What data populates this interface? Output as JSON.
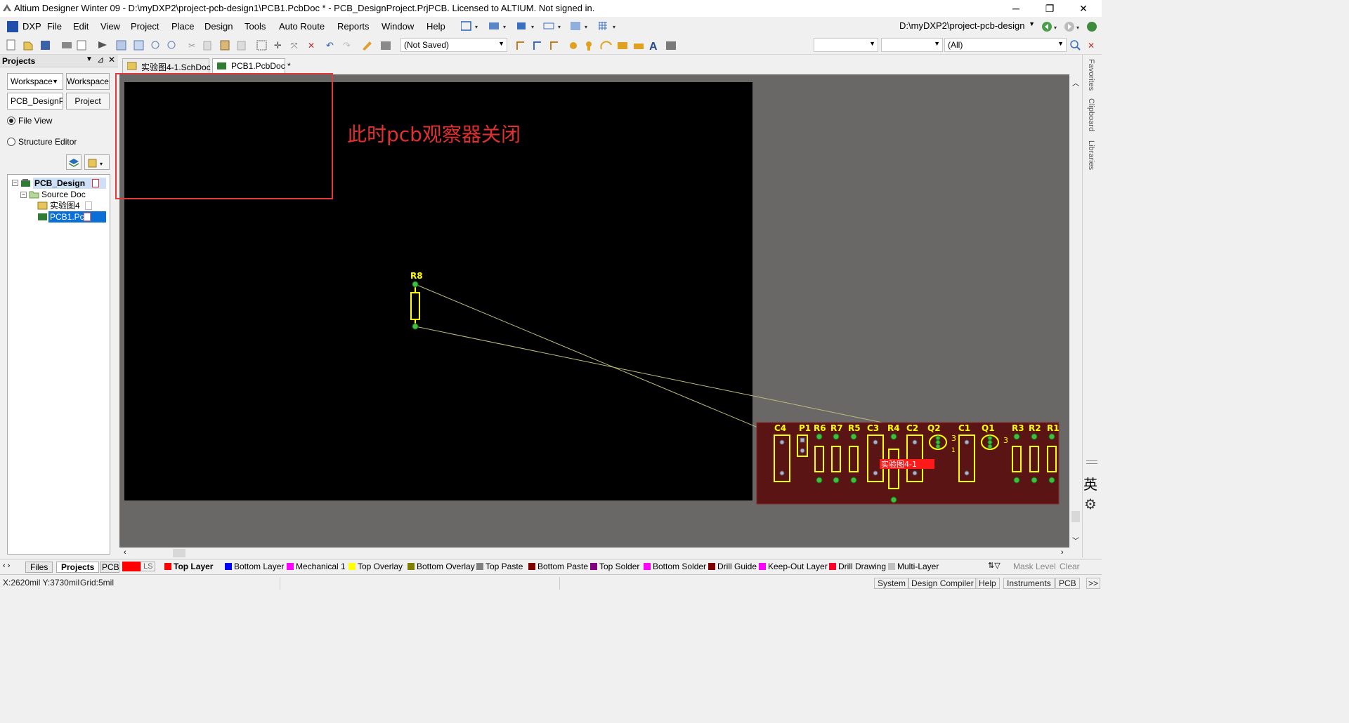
{
  "window": {
    "title": "Altium Designer Winter 09 - D:\\myDXP2\\project-pcb-design1\\PCB1.PcbDoc * - PCB_DesignProject.PrjPCB. Licensed to ALTIUM. Not signed in.",
    "minimize": "─",
    "restore": "❐",
    "close": "✕"
  },
  "menu": {
    "dxp": "DXP",
    "file": "File",
    "edit": "Edit",
    "view": "View",
    "project": "Project",
    "place": "Place",
    "design": "Design",
    "tools": "Tools",
    "autoroute": "Auto Route",
    "reports": "Reports",
    "window": "Window",
    "help": "Help",
    "path_combo": "D:\\myDXP2\\project-pcb-design"
  },
  "toolbar": {
    "saved_combo": "(Not Saved)",
    "filter_combo": "(All)"
  },
  "projects_panel": {
    "title": "Projects",
    "workspace_combo": "Workspace",
    "workspace_button": "Workspace",
    "project_combo": "PCB_DesignPr",
    "project_button": "Project",
    "radio_fileview": "File View",
    "radio_structure": "Structure Editor",
    "tree": {
      "project": "PCB_Design",
      "source_folder": "Source Doc",
      "schdoc": "实验图4",
      "pcbdoc": "PCB1.Pc"
    }
  },
  "doc_tabs": {
    "schdoc": "实验图4-1.SchDoc",
    "pcbdoc": "PCB1.PcbDoc *"
  },
  "annotation": {
    "text": "此时pcb观察器关闭"
  },
  "pcb": {
    "r8_label": "R8",
    "room_label": "实验图4-1",
    "components": [
      "C4",
      "P1",
      "R6",
      "R7",
      "R5",
      "C3",
      "R4",
      "C2",
      "Q2",
      "C1",
      "Q1",
      "R3",
      "R2",
      "R1"
    ],
    "pin3_a": "3",
    "pin3_b": "3",
    "pin1": "1",
    "colors": {
      "board": "#000000",
      "room": "#5a1414",
      "component": "#ffff00",
      "pad": "#3fbf3f",
      "rat": "#bdbd7a"
    }
  },
  "right_rail": {
    "favorites": "Favorites",
    "clipboard": "Clipboard",
    "libraries": "Libraries",
    "ime": "英"
  },
  "panel_tabs": {
    "files": "Files",
    "projects": "Projects",
    "pcb": "PCB"
  },
  "layers": {
    "ls": "LS",
    "items": [
      {
        "name": "Top Layer",
        "color": "#ff0000"
      },
      {
        "name": "Bottom Layer",
        "color": "#0000ff"
      },
      {
        "name": "Mechanical 1",
        "color": "#ff00ff"
      },
      {
        "name": "Top Overlay",
        "color": "#ffff00"
      },
      {
        "name": "Bottom Overlay",
        "color": "#808000"
      },
      {
        "name": "Top Paste",
        "color": "#808080"
      },
      {
        "name": "Bottom Paste",
        "color": "#800000"
      },
      {
        "name": "Top Solder",
        "color": "#800080"
      },
      {
        "name": "Bottom Solder",
        "color": "#ff00ff"
      },
      {
        "name": "Drill Guide",
        "color": "#800000"
      },
      {
        "name": "Keep-Out Layer",
        "color": "#ff00ff"
      },
      {
        "name": "Drill Drawing",
        "color": "#ff002a"
      },
      {
        "name": "Multi-Layer",
        "color": "#c0c0c0"
      }
    ],
    "mask_level": "Mask Level",
    "clear": "Clear"
  },
  "status": {
    "coords": "X:2620mil Y:3730mil",
    "grid": "Grid:5mil",
    "system": "System",
    "design_compiler": "Design Compiler",
    "help": "Help",
    "instruments": "Instruments",
    "pcb": "PCB",
    "more": ">>"
  }
}
